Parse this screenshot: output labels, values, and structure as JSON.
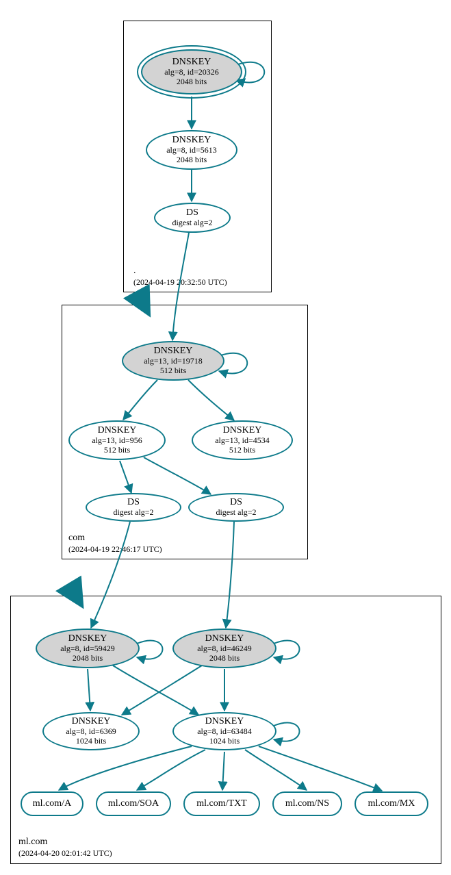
{
  "colors": {
    "stroke": "#0d7a8a",
    "fill": "#d3d3d3"
  },
  "zones": {
    "root": {
      "name": ".",
      "timestamp": "(2024-04-19 20:32:50 UTC)"
    },
    "com": {
      "name": "com",
      "timestamp": "(2024-04-19 22:46:17 UTC)"
    },
    "mlcom": {
      "name": "ml.com",
      "timestamp": "(2024-04-20 02:01:42 UTC)"
    }
  },
  "nodes": {
    "root_ksk": {
      "title": "DNSKEY",
      "line1": "alg=8, id=20326",
      "line2": "2048 bits"
    },
    "root_zsk": {
      "title": "DNSKEY",
      "line1": "alg=8, id=5613",
      "line2": "2048 bits"
    },
    "root_ds": {
      "title": "DS",
      "line1": "digest alg=2"
    },
    "com_ksk": {
      "title": "DNSKEY",
      "line1": "alg=13, id=19718",
      "line2": "512 bits"
    },
    "com_zsk1": {
      "title": "DNSKEY",
      "line1": "alg=13, id=956",
      "line2": "512 bits"
    },
    "com_zsk2": {
      "title": "DNSKEY",
      "line1": "alg=13, id=4534",
      "line2": "512 bits"
    },
    "com_ds1": {
      "title": "DS",
      "line1": "digest alg=2"
    },
    "com_ds2": {
      "title": "DS",
      "line1": "digest alg=2"
    },
    "ml_ksk1": {
      "title": "DNSKEY",
      "line1": "alg=8, id=59429",
      "line2": "2048 bits"
    },
    "ml_ksk2": {
      "title": "DNSKEY",
      "line1": "alg=8, id=46249",
      "line2": "2048 bits"
    },
    "ml_zsk1": {
      "title": "DNSKEY",
      "line1": "alg=8, id=6369",
      "line2": "1024 bits"
    },
    "ml_zsk2": {
      "title": "DNSKEY",
      "line1": "alg=8, id=63484",
      "line2": "1024 bits"
    },
    "rr_a": {
      "label": "ml.com/A"
    },
    "rr_soa": {
      "label": "ml.com/SOA"
    },
    "rr_txt": {
      "label": "ml.com/TXT"
    },
    "rr_ns": {
      "label": "ml.com/NS"
    },
    "rr_mx": {
      "label": "ml.com/MX"
    }
  }
}
